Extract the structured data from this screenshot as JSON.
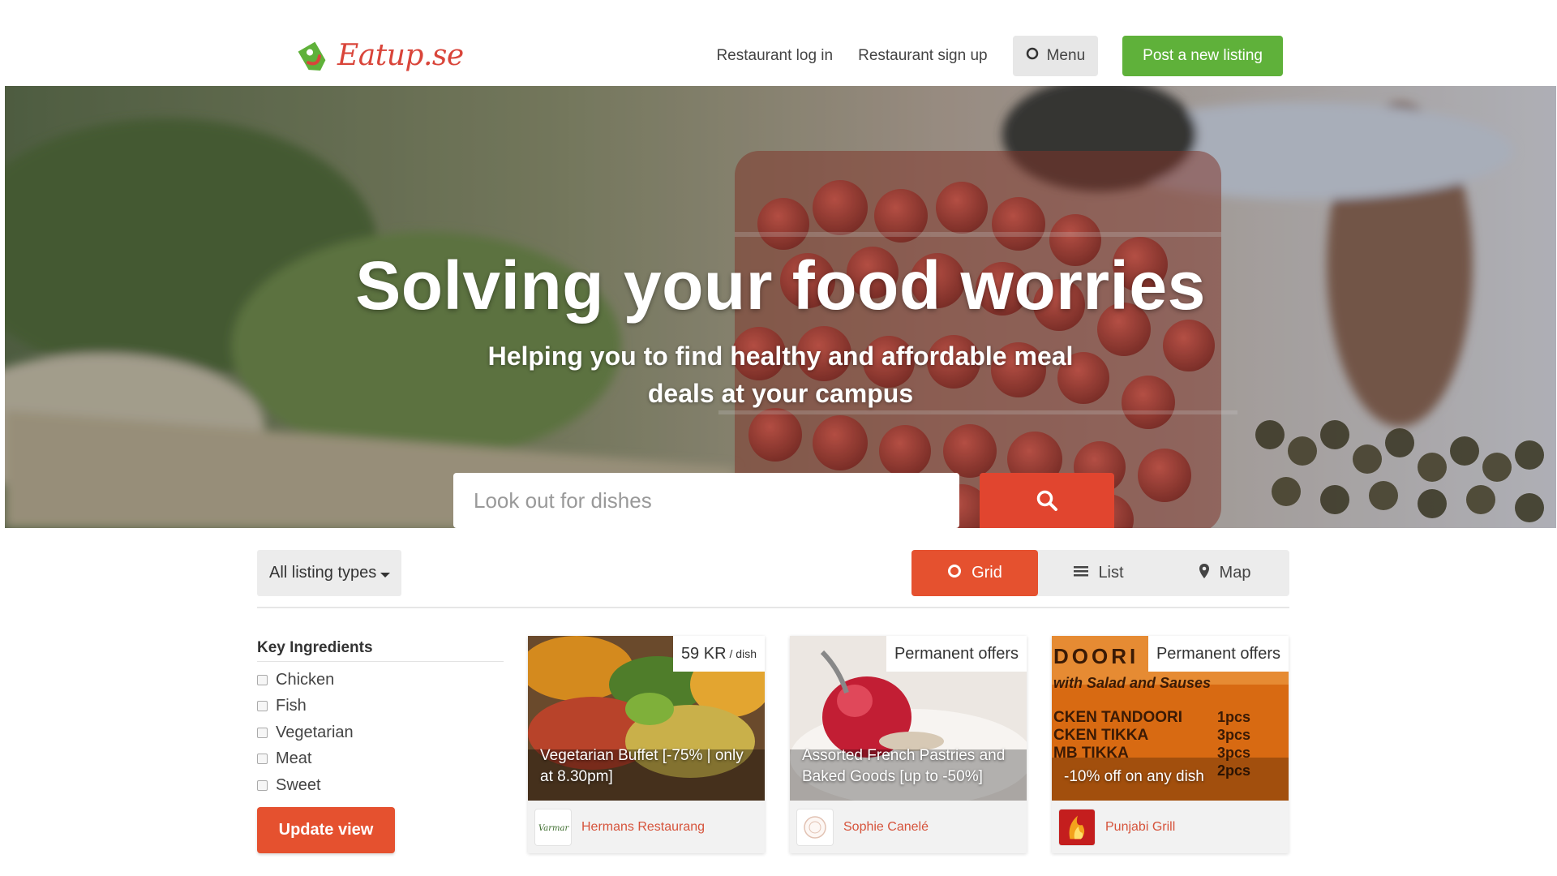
{
  "header": {
    "logo_text": "Eatup.se",
    "nav": {
      "login": "Restaurant log in",
      "signup": "Restaurant sign up",
      "menu": "Menu",
      "post": "Post a new listing"
    }
  },
  "hero": {
    "title": "Solving your food worries",
    "subtitle_line1": "Helping you to find healthy and affordable meal",
    "subtitle_line2": "deals at your campus",
    "search_placeholder": "Look out for dishes"
  },
  "filters": {
    "type_dropdown": "All listing types",
    "views": [
      {
        "label": "Grid",
        "active": true
      },
      {
        "label": "List",
        "active": false
      },
      {
        "label": "Map",
        "active": false
      }
    ]
  },
  "sidebar": {
    "title": "Key Ingredients",
    "options": [
      "Chicken",
      "Fish",
      "Vegetarian",
      "Meat",
      "Sweet"
    ],
    "update_label": "Update view"
  },
  "listings": [
    {
      "tag": "59 KR",
      "tag_unit": "/ dish",
      "caption": "Vegetarian Buffet [-75% | only at 8.30pm]",
      "restaurant": "Hermans Restaurang"
    },
    {
      "tag": "Permanent offers",
      "caption": "Assorted French Pastries and Baked Goods [up to -50%]",
      "restaurant": "Sophie Canelé"
    },
    {
      "tag": "Permanent offers",
      "caption": "-10% off on any dish",
      "restaurant": "Punjabi Grill"
    }
  ],
  "colors": {
    "brand_red": "#e5512f",
    "brand_green": "#5fb13a",
    "search_red": "#e1452f"
  }
}
